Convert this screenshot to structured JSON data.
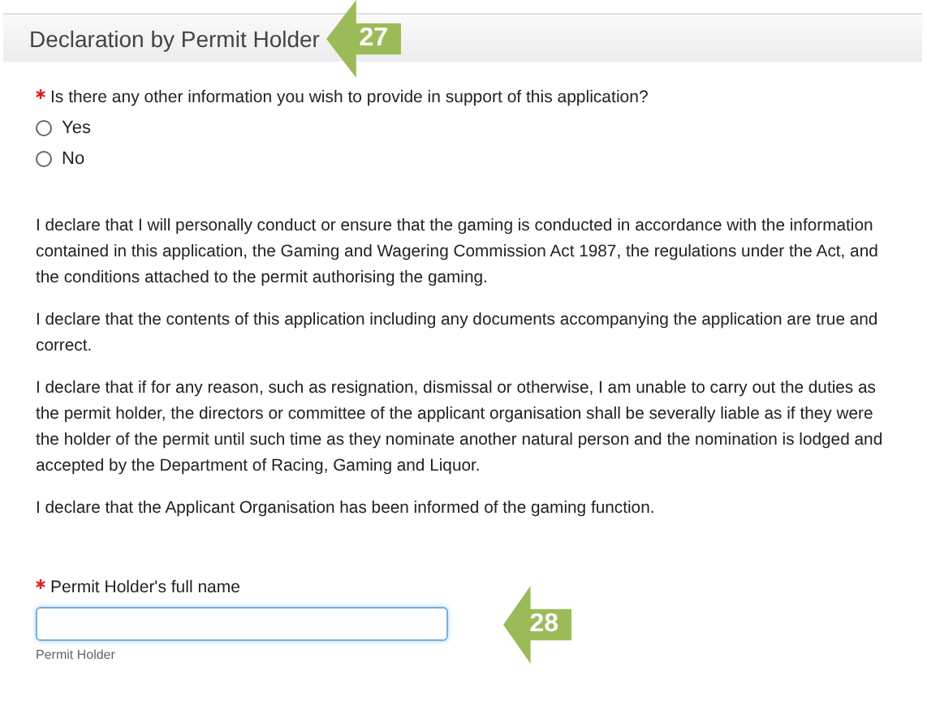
{
  "section": {
    "title": "Declaration by Permit Holder",
    "callout": "27"
  },
  "question": {
    "label": "Is there any other information you wish to provide in support of this application?",
    "required": true,
    "options": [
      {
        "label": "Yes",
        "selected": false
      },
      {
        "label": "No",
        "selected": false
      }
    ]
  },
  "declarations": [
    "I declare that I will personally conduct or ensure that the gaming is conducted in accordance with the information contained in this application, the Gaming and Wagering Commission Act 1987, the regulations under the Act, and the conditions attached to the permit authorising the gaming.",
    "I declare that the contents of this application including any documents accompanying the application are true and correct.",
    "I declare that if for any reason, such as resignation, dismissal or otherwise, I am unable to carry out the duties as the permit holder, the directors or committee of the applicant organisation shall be severally liable as if they were the holder of the permit until such time as they nominate another natural person and the nomination is lodged and accepted by the Department of Racing, Gaming and Liquor.",
    "I declare that the Applicant Organisation has been informed of the gaming function."
  ],
  "name_field": {
    "label": "Permit Holder's full name",
    "required": true,
    "help": "Permit Holder",
    "callout": "28"
  }
}
